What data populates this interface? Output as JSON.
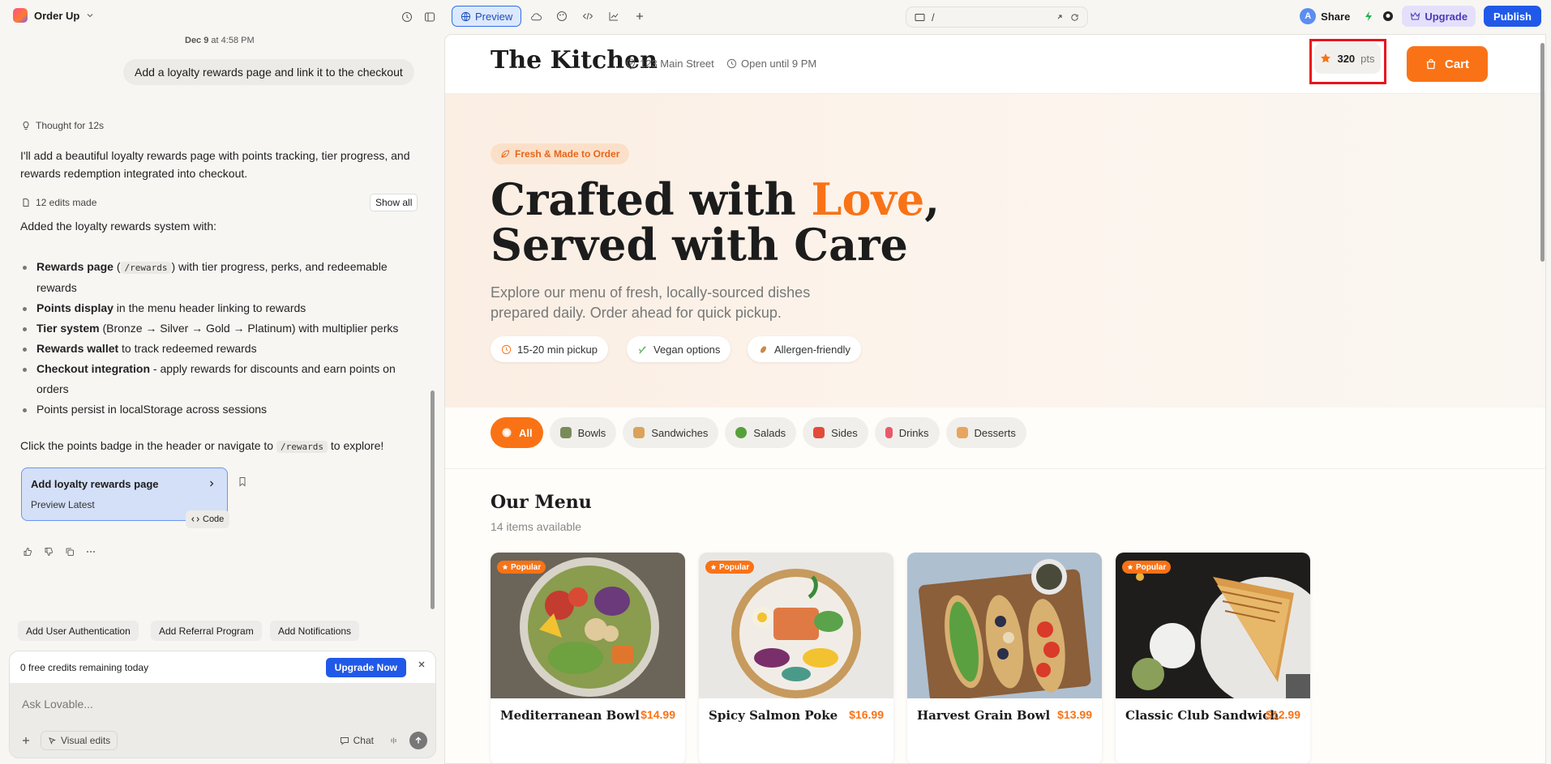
{
  "topbar": {
    "project_name": "Order Up",
    "preview_tab": "Preview",
    "url_path": "/",
    "share": "Share",
    "avatar_initial": "A",
    "upgrade": "Upgrade",
    "publish": "Publish"
  },
  "chat": {
    "timestamp_date": "Dec 9",
    "timestamp_time": "at 4:58 PM",
    "user_message": "Add a loyalty rewards page and link it to the checkout",
    "thought": "Thought for 12s",
    "intro": "I'll add a beautiful loyalty rewards page with points tracking, tier progress, and rewards redemption integrated into checkout.",
    "edits": "12 edits made",
    "show_all": "Show all",
    "added_heading": "Added the loyalty rewards system with:",
    "bullets": [
      {
        "bold": "Rewards page",
        "pre": " (",
        "code": "/rewards",
        "rest": ") with tier progress, perks, and redeemable rewards"
      },
      {
        "bold": "Points display",
        "rest": " in the menu header linking to rewards"
      },
      {
        "bold": "Tier system",
        "rest": " (Bronze → Silver → Gold → Platinum) with multiplier perks"
      },
      {
        "bold": "Rewards wallet",
        "rest": " to track redeemed rewards"
      },
      {
        "bold": "Checkout integration",
        "rest": " - apply rewards for discounts and earn points on orders"
      },
      {
        "bold": "",
        "rest": "Points persist in localStorage across sessions"
      }
    ],
    "closing_pre": "Click the points badge in the header or navigate to",
    "closing_code": "/rewards",
    "closing_post": "to explore!",
    "card_title": "Add loyalty rewards page",
    "card_sub": "Preview Latest",
    "code_btn": "Code",
    "suggestions": [
      "Add User Authentication",
      "Add Referral Program",
      "Add Notifications"
    ],
    "credits": "0 free credits remaining today",
    "upgrade_now": "Upgrade Now",
    "input_placeholder": "Ask Lovable...",
    "visual_edits": "Visual edits",
    "chat_btn": "Chat"
  },
  "site": {
    "brand": "The Kitchen",
    "address": "123 Main Street",
    "hours": "Open until 9 PM",
    "points_value": "320",
    "points_unit": "pts",
    "cart": "Cart",
    "badge": "Fresh & Made to Order",
    "headline_1a": "Crafted with ",
    "headline_1b": "Love",
    "headline_1c": ",",
    "headline_2": "Served with Care",
    "subtext": "Explore our menu of fresh, locally-sourced dishes prepared daily. Order ahead for quick pickup.",
    "features": [
      "15-20 min pickup",
      "Vegan options",
      "Allergen-friendly"
    ],
    "categories": [
      "All",
      "Bowls",
      "Sandwiches",
      "Salads",
      "Sides",
      "Drinks",
      "Desserts"
    ],
    "menu_title": "Our Menu",
    "menu_count": "14 items available",
    "popular_label": "Popular",
    "items": [
      {
        "name": "Mediterranean Bowl",
        "price": "$14.99",
        "popular": true
      },
      {
        "name": "Spicy Salmon Poke",
        "price": "$16.99",
        "popular": true
      },
      {
        "name": "Harvest Grain Bowl",
        "price": "$13.99",
        "popular": false
      },
      {
        "name": "Classic Club Sandwich",
        "price": "$12.99",
        "popular": true
      }
    ]
  },
  "colors": {
    "accent": "#f97316",
    "primary_blue": "#2059e8",
    "highlight": "#e8141e"
  }
}
